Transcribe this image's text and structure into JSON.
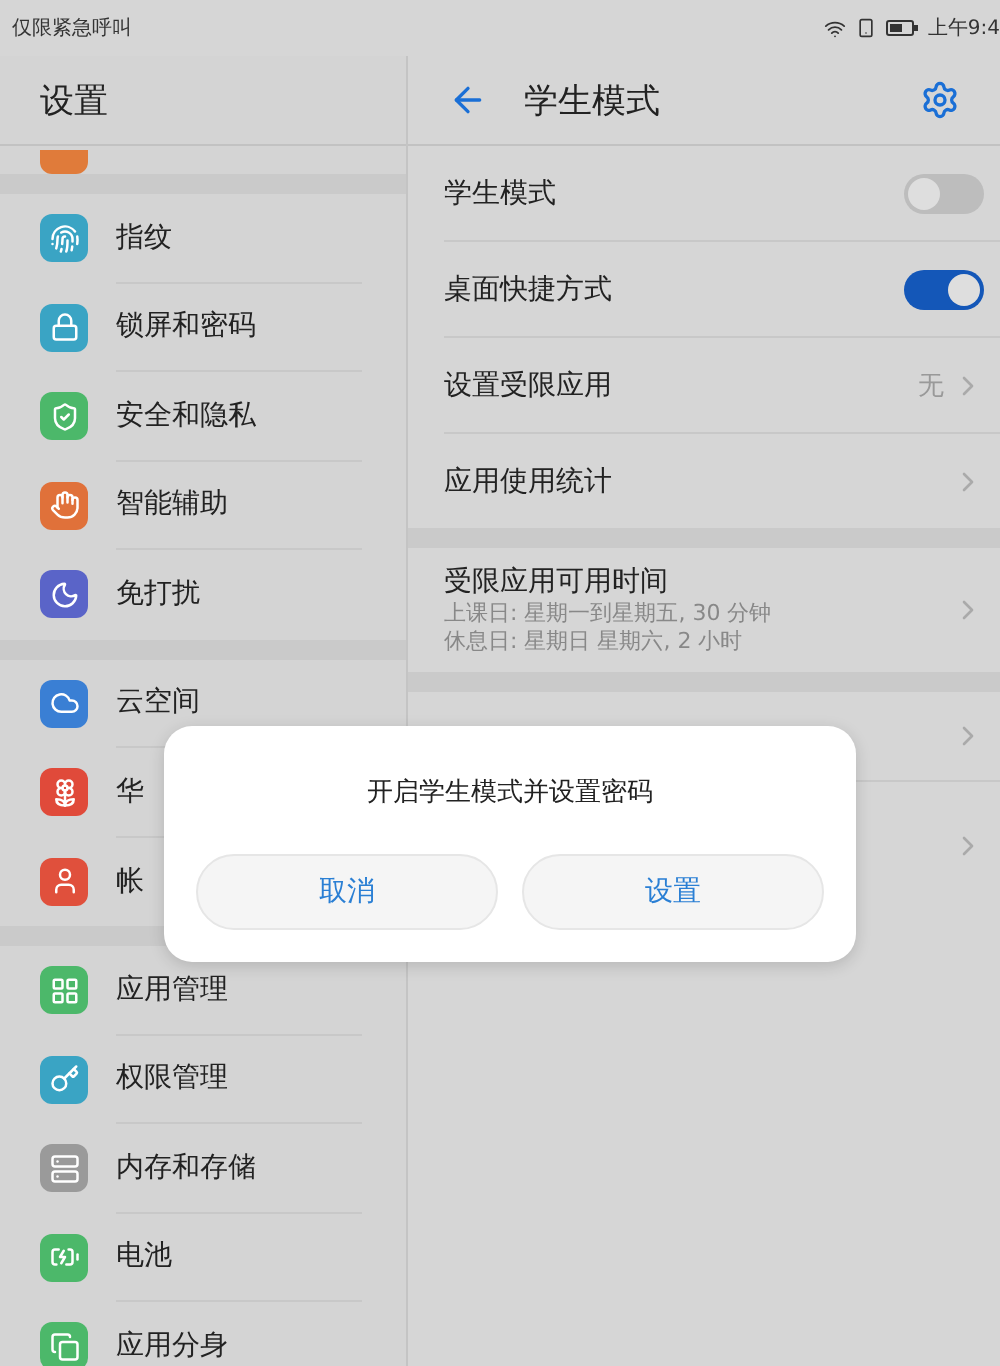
{
  "status_bar": {
    "left_text": "仅限紧急呼叫",
    "time": "上午9:4"
  },
  "sidebar": {
    "title": "设置",
    "groups": [
      {
        "items": [
          {
            "kind": "cut",
            "color": "#e07b3a"
          }
        ]
      },
      {
        "items": [
          {
            "kind": "item",
            "label": "指纹",
            "color": "#3aa4c4"
          },
          {
            "kind": "item",
            "label": "锁屏和密码",
            "color": "#3aa4c4"
          },
          {
            "kind": "item",
            "label": "安全和隐私",
            "color": "#4cb86a"
          },
          {
            "kind": "item",
            "label": "智能辅助",
            "color": "#e0713a"
          },
          {
            "kind": "item",
            "label": "免打扰",
            "color": "#5a64c8"
          }
        ]
      },
      {
        "items": [
          {
            "kind": "item",
            "label": "云空间",
            "color": "#3a7fd4"
          },
          {
            "kind": "item",
            "label": "华",
            "color": "#e04a3a"
          },
          {
            "kind": "item",
            "label": "帐",
            "color": "#e0503c"
          }
        ]
      },
      {
        "items": [
          {
            "kind": "item",
            "label": "应用管理",
            "color": "#4cb86a"
          },
          {
            "kind": "item",
            "label": "权限管理",
            "color": "#3aa4c4"
          },
          {
            "kind": "item",
            "label": "内存和存储",
            "color": "#9a9a9a"
          },
          {
            "kind": "item",
            "label": "电池",
            "color": "#4cb86a"
          },
          {
            "kind": "item",
            "label": "应用分身",
            "color": "#4cb86a"
          }
        ]
      }
    ]
  },
  "detail": {
    "title": "学生模式",
    "groups": [
      {
        "rows": [
          {
            "kind": "switch",
            "label": "学生模式",
            "on": false
          },
          {
            "kind": "switch",
            "label": "桌面快捷方式",
            "on": true
          },
          {
            "kind": "value",
            "label": "设置受限应用",
            "value": "无"
          },
          {
            "kind": "link",
            "label": "应用使用统计"
          }
        ]
      },
      {
        "rows": [
          {
            "kind": "detail",
            "label": "受限应用可用时间",
            "lines": [
              "上课日: 星期一到星期五, 30 分钟",
              "休息日: 星期日 星期六, 2 小时"
            ]
          }
        ]
      },
      {
        "rows": [
          {
            "kind": "covered"
          },
          {
            "kind": "covered"
          }
        ]
      }
    ]
  },
  "dialog": {
    "message": "开启学生模式并设置密码",
    "buttons": [
      "取消",
      "设置"
    ]
  }
}
